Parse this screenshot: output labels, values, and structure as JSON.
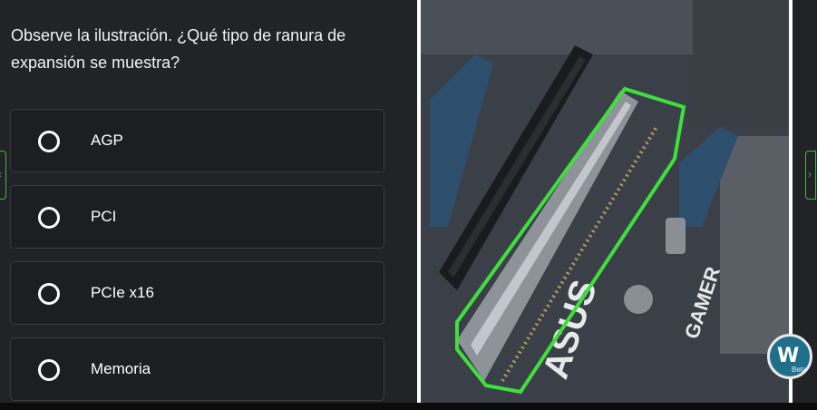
{
  "question": {
    "text": "Observe la ilustración. ¿Qué tipo de ranura de expansión se muestra?"
  },
  "options": [
    {
      "label": "AGP"
    },
    {
      "label": "PCI"
    },
    {
      "label": "PCIe x16"
    },
    {
      "label": "Memoria"
    }
  ],
  "image": {
    "board_text_1": "ASUS",
    "board_text_2": "GAMER",
    "highlight_color": "#3ee03e"
  },
  "badge": {
    "logo": "W",
    "label": "Beta"
  },
  "nav": {
    "prev_icon": "chevron-left-icon",
    "next_icon": "chevron-right-icon"
  }
}
